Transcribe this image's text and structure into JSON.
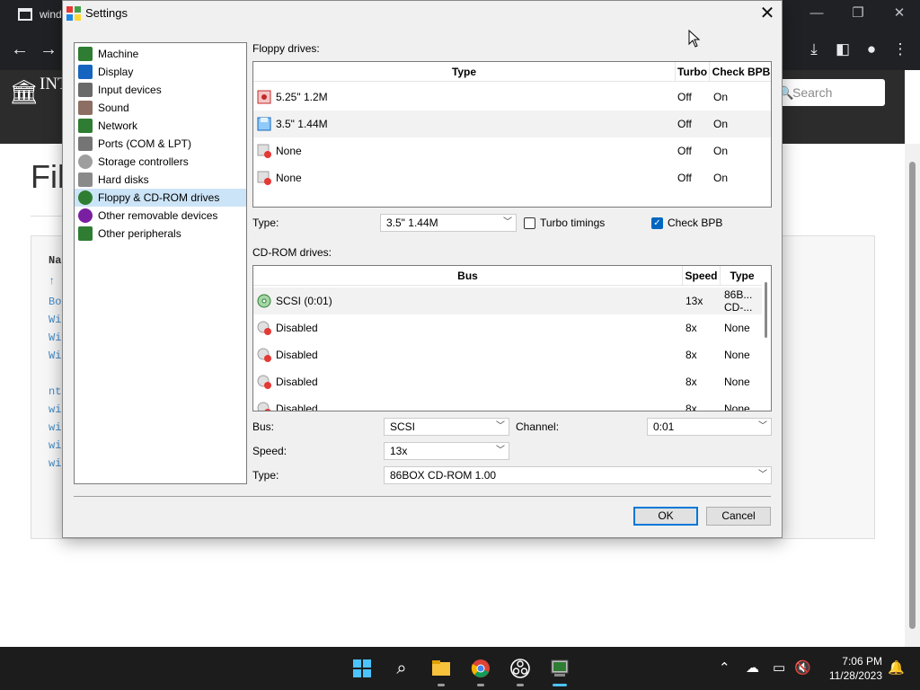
{
  "browser": {
    "tab_title": "wind",
    "site_title": "INTERNET ARCHIVE",
    "search_placeholder": "Search",
    "page_title": "Fil",
    "links": [
      "Na",
      "↑",
      "Bo",
      "Wi",
      "Wi",
      "Wi",
      "nt",
      "wi",
      "wi",
      "wi",
      "wi"
    ]
  },
  "dialog": {
    "title": "Settings",
    "nav_items": [
      {
        "label": "Machine",
        "color": "#2e7d32"
      },
      {
        "label": "Display",
        "color": "#1565c0"
      },
      {
        "label": "Input devices",
        "color": "#6a6a6a"
      },
      {
        "label": "Sound",
        "color": "#8d6e63"
      },
      {
        "label": "Network",
        "color": "#2e7d32"
      },
      {
        "label": "Ports (COM & LPT)",
        "color": "#757575"
      },
      {
        "label": "Storage controllers",
        "color": "#9e9e9e"
      },
      {
        "label": "Hard disks",
        "color": "#8a8a8a"
      },
      {
        "label": "Floppy & CD-ROM drives",
        "color": "#2e7d32"
      },
      {
        "label": "Other removable devices",
        "color": "#7b1fa2"
      },
      {
        "label": "Other peripherals",
        "color": "#2e7d32"
      }
    ],
    "selected_nav": "Floppy & CD-ROM drives",
    "floppy": {
      "section_label": "Floppy drives:",
      "columns": {
        "type": "Type",
        "turbo": "Turbo",
        "bpb": "Check BPB"
      },
      "rows": [
        {
          "type": "5.25\" 1.2M",
          "turbo": "Off",
          "bpb": "On",
          "icon": "floppy-525-icon"
        },
        {
          "type": "3.5\" 1.44M",
          "turbo": "Off",
          "bpb": "On",
          "icon": "floppy-35-icon"
        },
        {
          "type": "None",
          "turbo": "Off",
          "bpb": "On",
          "icon": "floppy-disabled-icon"
        },
        {
          "type": "None",
          "turbo": "Off",
          "bpb": "On",
          "icon": "floppy-disabled-icon"
        }
      ],
      "type_label": "Type:",
      "type_value": "3.5\" 1.44M",
      "turbo_label": "Turbo timings",
      "turbo_checked": false,
      "bpb_label": "Check BPB",
      "bpb_checked": true
    },
    "cdrom": {
      "section_label": "CD-ROM drives:",
      "columns": {
        "bus": "Bus",
        "speed": "Speed",
        "type": "Type"
      },
      "rows": [
        {
          "bus": "SCSI (0:01)",
          "speed": "13x",
          "type": "86B... CD-...",
          "icon": "cdrom-icon"
        },
        {
          "bus": "Disabled",
          "speed": "8x",
          "type": "None",
          "icon": "cdrom-disabled-icon"
        },
        {
          "bus": "Disabled",
          "speed": "8x",
          "type": "None",
          "icon": "cdrom-disabled-icon"
        },
        {
          "bus": "Disabled",
          "speed": "8x",
          "type": "None",
          "icon": "cdrom-disabled-icon"
        },
        {
          "bus": "Disabled",
          "speed": "8x",
          "type": "None",
          "icon": "cdrom-disabled-icon"
        }
      ],
      "bus_label": "Bus:",
      "bus_value": "SCSI",
      "channel_label": "Channel:",
      "channel_value": "0:01",
      "speed_label": "Speed:",
      "speed_value": "13x",
      "type_label": "Type:",
      "type_value": "86BOX CD-ROM 1.00"
    },
    "ok_label": "OK",
    "cancel_label": "Cancel"
  },
  "taskbar": {
    "time": "7:06 PM",
    "date": "11/28/2023"
  }
}
